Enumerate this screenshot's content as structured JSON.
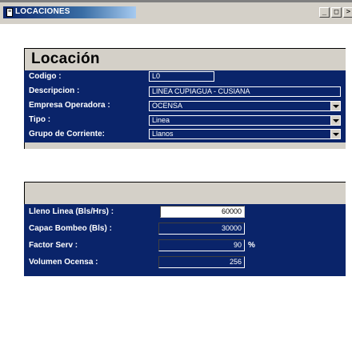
{
  "window": {
    "title": "LOCACIONES",
    "buttons": {
      "minimize": "_",
      "restore": "□",
      "more": ">"
    }
  },
  "form": {
    "heading": "Locación",
    "fields": [
      {
        "label": "Codigo :",
        "value": "L0"
      },
      {
        "label": "Descripcion :",
        "value": "LINEA CUPIAGUA - CUSIANA"
      },
      {
        "label": "Empresa Operadora :",
        "value": "OCENSA"
      },
      {
        "label": "Tipo :",
        "value": "Linea"
      },
      {
        "label": "Grupo de Corriente:",
        "value": "Llanos"
      }
    ]
  },
  "metrics": {
    "fields": [
      {
        "label": "Lleno Linea (Bls/Hrs) :",
        "value": "60000",
        "unit": ""
      },
      {
        "label": "Capac Bombeo (Bls) :",
        "value": "30000",
        "unit": ""
      },
      {
        "label": "Factor Serv :",
        "value": "90",
        "unit": "%"
      },
      {
        "label": "Volumen Ocensa :",
        "value": "256",
        "unit": ""
      }
    ]
  },
  "colors": {
    "navy": "#0a246a",
    "face": "#d4d0c8",
    "title_gradient_start": "#0a246a",
    "title_gradient_end": "#a6caf0"
  }
}
